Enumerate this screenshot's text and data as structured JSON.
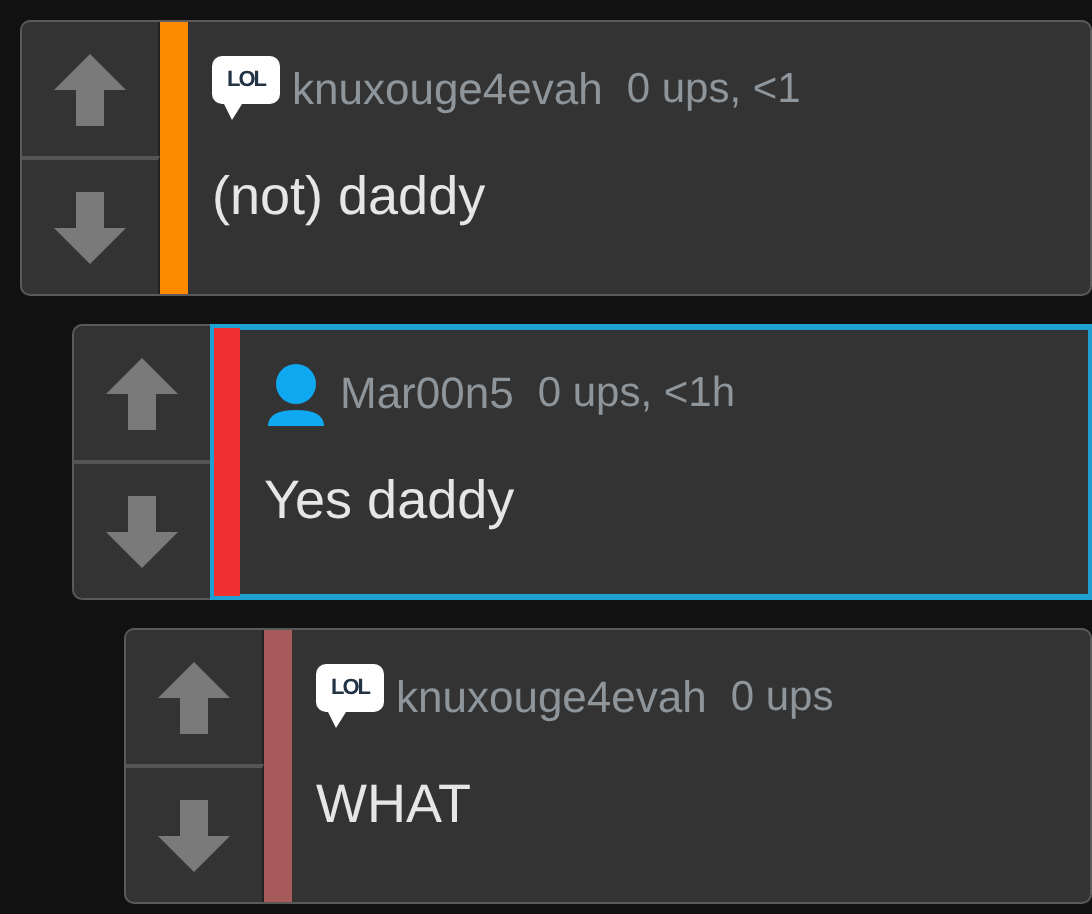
{
  "comments": [
    {
      "avatar": {
        "kind": "bubble",
        "text": "LOL"
      },
      "username": "knuxouge4evah",
      "meta": "0 ups, <1",
      "text": "(not) daddy",
      "color": "#ff8c00",
      "highlighted": false,
      "children": [
        {
          "avatar": {
            "kind": "person"
          },
          "username": "Mar00n5",
          "meta": "0 ups, <1h",
          "text": "Yes daddy",
          "color": "#f03030",
          "highlighted": true,
          "children": [
            {
              "avatar": {
                "kind": "bubble",
                "text": "LOL"
              },
              "username": "knuxouge4evah",
              "meta": "0 ups",
              "text": "WHAT",
              "color": "#a65a5a",
              "highlighted": false
            }
          ]
        }
      ]
    }
  ]
}
